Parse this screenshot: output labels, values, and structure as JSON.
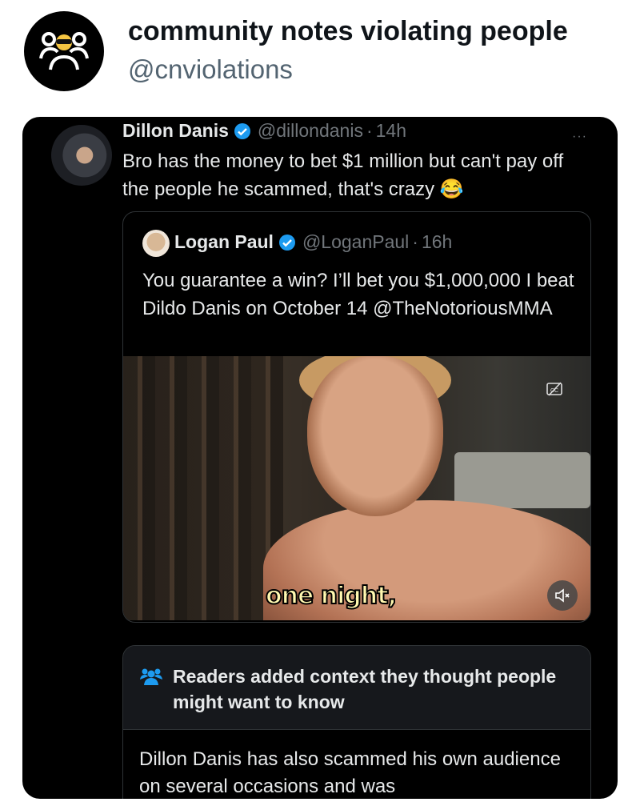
{
  "header": {
    "account_name": "community notes violating people",
    "account_handle": "@cnviolations"
  },
  "tweet": {
    "author_name": "Dillon Danis",
    "handle": "@dillondanis",
    "time": "14h",
    "separator": "·",
    "more": "···",
    "text": "Bro has the money to bet $1 million but can't pay off the people he scammed, that's crazy",
    "emoji": "😂"
  },
  "quote": {
    "author_name": "Logan Paul",
    "handle": "@LoganPaul",
    "time": "16h",
    "separator": "·",
    "text": "You guarantee a win? I’ll bet you $1,000,000 I beat Dildo Danis on October 14 @TheNotoriousMMA",
    "video_caption": "one night,"
  },
  "community_note": {
    "title": "Readers added context they thought people might want to know",
    "text": "Dillon Danis has also scammed his own audience on several occasions and was"
  },
  "colors": {
    "verified_blue": "#1d9bf0",
    "card_bg": "#000000",
    "text_primary": "#e7e9ea",
    "text_secondary": "#71767b",
    "note_accent": "#1d9bf0"
  }
}
